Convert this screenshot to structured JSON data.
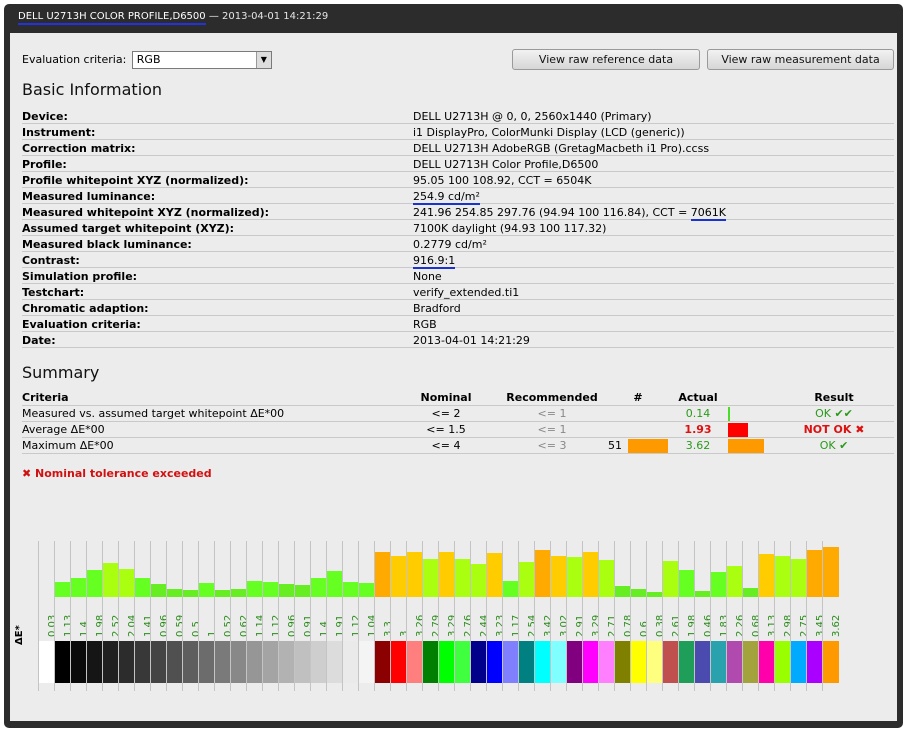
{
  "window": {
    "title_profile": "DELL U2713H COLOR PROFILE,D6500",
    "title_rest": " — 2013-04-01 14:21:29"
  },
  "toolbar": {
    "eval_label": "Evaluation criteria:",
    "eval_value": "RGB",
    "btn_reference": "View raw reference data",
    "btn_measurement": "View raw measurement data"
  },
  "basic": {
    "heading": "Basic Information",
    "rows": [
      {
        "k": "Device:",
        "v": "DELL U2713H @ 0, 0, 2560x1440 (Primary)"
      },
      {
        "k": "Instrument:",
        "v": "i1 DisplayPro, ColorMunki Display (LCD (generic))"
      },
      {
        "k": "Correction matrix:",
        "v": "DELL U2713H AdobeRGB (GretagMacbeth i1 Pro).ccss"
      },
      {
        "k": "Profile:",
        "v": "DELL U2713H Color Profile,D6500"
      },
      {
        "k": "Profile whitepoint XYZ (normalized):",
        "v": "95.05 100 108.92, CCT = 6504K"
      },
      {
        "k": "Measured luminance:",
        "v": "254.9 cd/m²"
      },
      {
        "k": "Measured whitepoint XYZ (normalized):",
        "v": "241.96 254.85 297.76 (94.94 100 116.84), CCT = ",
        "v2": "7061K"
      },
      {
        "k": "Assumed target whitepoint (XYZ):",
        "v": "7100K daylight (94.93 100 117.32)"
      },
      {
        "k": "Measured black luminance:",
        "v": "0.2779 cd/m²"
      },
      {
        "k": "Contrast:",
        "v": "916.9:1"
      },
      {
        "k": "Simulation profile:",
        "v": "None"
      },
      {
        "k": "Testchart:",
        "v": "verify_extended.ti1"
      },
      {
        "k": "Chromatic adaption:",
        "v": "Bradford"
      },
      {
        "k": "Evaluation criteria:",
        "v": "RGB"
      },
      {
        "k": "Date:",
        "v": "2013-04-01 14:21:29"
      }
    ]
  },
  "summary": {
    "heading": "Summary",
    "headers": {
      "criteria": "Criteria",
      "nominal": "Nominal",
      "recommended": "Recommended",
      "num": "#",
      "actual": "Actual",
      "result": "Result"
    },
    "rows": [
      {
        "criteria": "Measured vs. assumed target whitepoint ΔE*00",
        "nominal": "<= 2",
        "recommended": "<= 1",
        "num": "",
        "actual": "0.14",
        "result": "OK ✔✔",
        "actual_color": "#4bdc2a",
        "fraction": 0.02
      },
      {
        "criteria": "Average ΔE*00",
        "nominal": "<= 1.5",
        "recommended": "<= 1",
        "num": "",
        "actual": "1.93",
        "result": "NOT OK ✖",
        "actual_color": "#ff0000",
        "fraction": 0.5
      },
      {
        "criteria": "Maximum ΔE*00",
        "nominal": "<= 4",
        "recommended": "<= 3",
        "num": "51",
        "actual": "3.62",
        "result": "OK ✔",
        "actual_color": "#ff9900",
        "fraction": 0.9
      }
    ],
    "warning": "✖ Nominal tolerance exceeded"
  },
  "chart": {
    "ylabel": "ΔE*",
    "values": [
      "0.03",
      "1.13",
      "1.4",
      "1.98",
      "2.52",
      "2.04",
      "1.41",
      "0.96",
      "0.59",
      "0.5",
      "1",
      "0.52",
      "0.62",
      "1.14",
      "1.12",
      "0.96",
      "0.91",
      "1.4",
      "1.91",
      "1.12",
      "1.04",
      "3.3",
      "3",
      "3.26",
      "2.79",
      "3.29",
      "2.76",
      "2.44",
      "3.23",
      "1.17",
      "2.54",
      "3.42",
      "3.02",
      "2.91",
      "3.29",
      "2.71",
      "0.78",
      "0.6",
      "0.38",
      "2.61",
      "1.98",
      "0.46",
      "1.83",
      "2.26",
      "0.68",
      "3.13",
      "2.98",
      "2.75",
      "3.45",
      "3.62"
    ],
    "swatches": [
      "#ffffff",
      "#000000",
      "#0a0a0a",
      "#151515",
      "#202020",
      "#2c2c2c",
      "#383838",
      "#444444",
      "#505050",
      "#5e5e5e",
      "#6c6c6c",
      "#7a7a7a",
      "#888888",
      "#969696",
      "#a4a4a4",
      "#b2b2b2",
      "#c0c0c0",
      "#cecece",
      "#dcdcdc",
      "#eaeaea",
      "#f4f4f4",
      "#8b0000",
      "#ff0000",
      "#ff7f7f",
      "#007f00",
      "#00ff00",
      "#3fff3f",
      "#00008b",
      "#0000ff",
      "#8080ff",
      "#008080",
      "#00ffff",
      "#7fffff",
      "#800080",
      "#ff00ff",
      "#ff7fff",
      "#7f7f00",
      "#ffff00",
      "#ffff7f",
      "#c0504d",
      "#1f9e5a",
      "#4a4aaf",
      "#2aa2ad",
      "#b04aaf",
      "#a3a33d",
      "#ff00aa",
      "#99ff00",
      "#00aaff",
      "#aa00ff",
      "#ff9900"
    ]
  }
}
